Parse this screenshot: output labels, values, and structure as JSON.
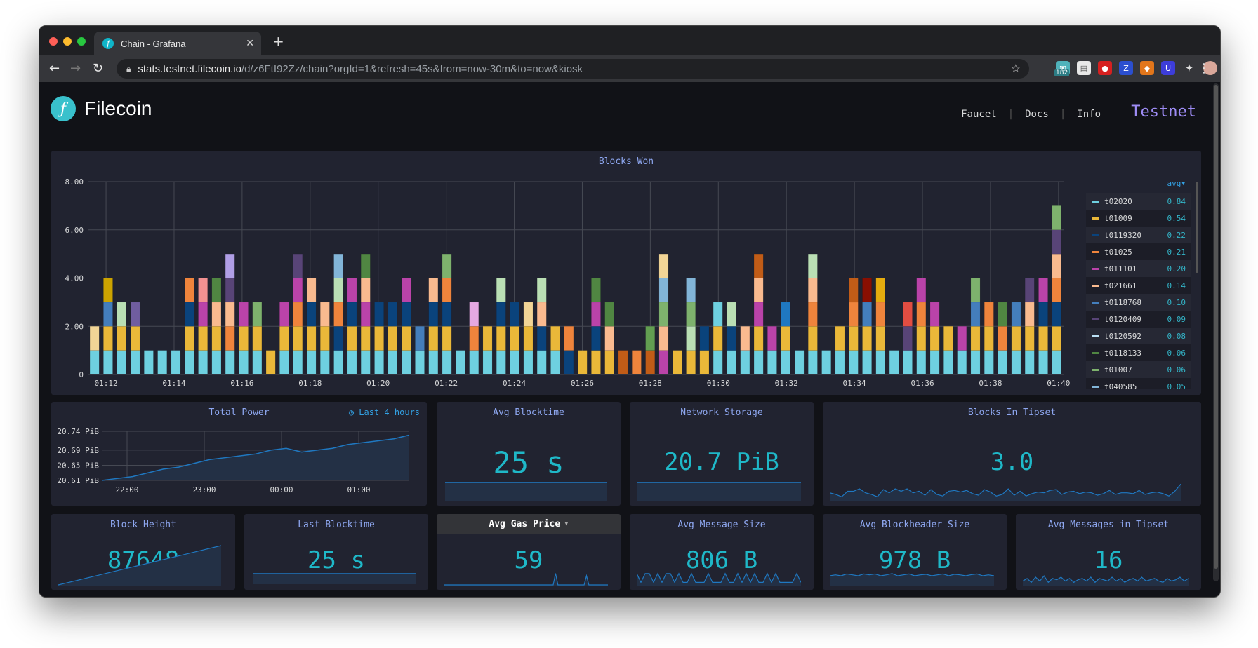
{
  "browser": {
    "tab_title": "Chain - Grafana",
    "url_host": "stats.testnet.filecoin.io",
    "url_path": "/d/z6FtI92Zz/chain?orgId=1&refresh=45s&from=now-30m&to=now&kiosk",
    "extension_badge": "182",
    "colors": {
      "close": "#ff5f57",
      "minimize": "#febc2e",
      "maximize": "#28c840"
    }
  },
  "header": {
    "brand": "Filecoin",
    "logo_glyph": "ƒ",
    "nav": [
      "Faucet",
      "Docs",
      "Info"
    ],
    "network": "Testnet"
  },
  "blocks_won": {
    "title": "Blocks Won",
    "legend_sort": "avg▾",
    "legend": [
      {
        "name": "t02020",
        "value": "0.84",
        "color": "#6ed0e0"
      },
      {
        "name": "t01009",
        "value": "0.54",
        "color": "#eab839"
      },
      {
        "name": "t0119320",
        "value": "0.22",
        "color": "#0a437c"
      },
      {
        "name": "t01025",
        "value": "0.21",
        "color": "#ef843c"
      },
      {
        "name": "t011101",
        "value": "0.20",
        "color": "#ba43a9"
      },
      {
        "name": "t021661",
        "value": "0.14",
        "color": "#f9ba8f"
      },
      {
        "name": "t0118768",
        "value": "0.10",
        "color": "#447ebc"
      },
      {
        "name": "t0120409",
        "value": "0.09",
        "color": "#584477"
      },
      {
        "name": "t0120592",
        "value": "0.08",
        "color": "#badff4"
      },
      {
        "name": "t0118133",
        "value": "0.06",
        "color": "#508642"
      },
      {
        "name": "t01007",
        "value": "0.06",
        "color": "#7eb26d"
      },
      {
        "name": "t040585",
        "value": "0.05",
        "color": "#82b5d8"
      }
    ]
  },
  "chart_data": [
    {
      "type": "bar",
      "title": "Blocks Won",
      "stacked": true,
      "ylim": [
        0,
        8
      ],
      "yticks": [
        "0",
        "2.00",
        "4.00",
        "6.00",
        "8.00"
      ],
      "xticks": [
        "01:12",
        "01:14",
        "01:16",
        "01:18",
        "01:20",
        "01:22",
        "01:24",
        "01:26",
        "01:28",
        "01:30",
        "01:32",
        "01:34",
        "01:36",
        "01:38",
        "01:40"
      ],
      "grid": true,
      "legend_position": "right",
      "stacks": [
        [
          "#6ed0e0",
          "#f2d596"
        ],
        [
          "#6ed0e0",
          "#eab839",
          "#447ebc",
          "#cca300"
        ],
        [
          "#6ed0e0",
          "#eab839",
          "#badfb4"
        ],
        [
          "#6ed0e0",
          "#eab839",
          "#705da0"
        ],
        [
          "#6ed0e0"
        ],
        [
          "#6ed0e0"
        ],
        [
          "#6ed0e0"
        ],
        [
          "#6ed0e0",
          "#eab839",
          "#0a437c",
          "#ef843c"
        ],
        [
          "#6ed0e0",
          "#eab839",
          "#ba43a9",
          "#f29191"
        ],
        [
          "#6ed0e0",
          "#eab839",
          "#f9ba8f",
          "#508642"
        ],
        [
          "#6ed0e0",
          "#ef843c",
          "#f9ba8f",
          "#584477",
          "#b09ee6"
        ],
        [
          "#6ed0e0",
          "#eab839",
          "#ba43a9"
        ],
        [
          "#6ed0e0",
          "#eab839",
          "#7eb26d"
        ],
        [
          "#eab839"
        ],
        [
          "#6ed0e0",
          "#eab839",
          "#ba43a9"
        ],
        [
          "#6ed0e0",
          "#eab839",
          "#ef843c",
          "#ba43a9",
          "#584477"
        ],
        [
          "#6ed0e0",
          "#eab839",
          "#0a437c",
          "#f9ba8f"
        ],
        [
          "#6ed0e0",
          "#eab839",
          "#f9ba8f"
        ],
        [
          "#6ed0e0",
          "#0a437c",
          "#ef843c",
          "#badfb4",
          "#82b5d8"
        ],
        [
          "#6ed0e0",
          "#eab839",
          "#0a437c",
          "#ba43a9"
        ],
        [
          "#6ed0e0",
          "#eab839",
          "#ba43a9",
          "#f9ba8f",
          "#508642"
        ],
        [
          "#6ed0e0",
          "#eab839",
          "#0a437c"
        ],
        [
          "#6ed0e0",
          "#eab839",
          "#0a437c"
        ],
        [
          "#6ed0e0",
          "#eab839",
          "#0a437c",
          "#ba43a9"
        ],
        [
          "#6ed0e0",
          "#447ebc"
        ],
        [
          "#6ed0e0",
          "#eab839",
          "#0a437c",
          "#f9ba8f"
        ],
        [
          "#6ed0e0",
          "#eab839",
          "#0a437c",
          "#ef843c",
          "#7eb26d"
        ],
        [
          "#6ed0e0"
        ],
        [
          "#6ed0e0",
          "#ef843c",
          "#e5a8e2"
        ],
        [
          "#6ed0e0",
          "#eab839"
        ],
        [
          "#6ed0e0",
          "#eab839",
          "#0a437c",
          "#badfb4"
        ],
        [
          "#6ed0e0",
          "#eab839",
          "#0a437c"
        ],
        [
          "#6ed0e0",
          "#eab839",
          "#f2d596"
        ],
        [
          "#6ed0e0",
          "#0a437c",
          "#f9ba8f",
          "#badfb4"
        ],
        [
          "#6ed0e0",
          "#eab839"
        ],
        [
          "#0a437c",
          "#ef843c"
        ],
        [
          "#eab839"
        ],
        [
          "#eab839",
          "#0a437c",
          "#ba43a9",
          "#508642"
        ],
        [
          "#eab839",
          "#f9ba8f",
          "#508642"
        ],
        [
          "#c15c17"
        ],
        [
          "#ef843c"
        ],
        [
          "#c15c17",
          "#629e51"
        ],
        [
          "#ba43a9",
          "#f9ba8f",
          "#7eb26d",
          "#82b5d8",
          "#f2d596"
        ],
        [
          "#eab839"
        ],
        [
          "#eab839",
          "#badfb4",
          "#7eb26d",
          "#82b5d8"
        ],
        [
          "#eab839",
          "#0a437c"
        ],
        [
          "#6ed0e0",
          "#eab839",
          "#6ed0e0"
        ],
        [
          "#6ed0e0",
          "#0a437c",
          "#badfb4"
        ],
        [
          "#6ed0e0",
          "#f9ba8f"
        ],
        [
          "#6ed0e0",
          "#eab839",
          "#ba43a9",
          "#f9ba8f",
          "#c15c17"
        ],
        [
          "#6ed0e0",
          "#ba43a9"
        ],
        [
          "#6ed0e0",
          "#eab839",
          "#1f78c1"
        ],
        [
          "#6ed0e0"
        ],
        [
          "#6ed0e0",
          "#eab839",
          "#ef843c",
          "#f9ba8f",
          "#badfb4"
        ],
        [
          "#6ed0e0"
        ],
        [
          "#6ed0e0",
          "#eab839"
        ],
        [
          "#6ed0e0",
          "#eab839",
          "#ef843c",
          "#c15c17"
        ],
        [
          "#6ed0e0",
          "#eab839",
          "#447ebc",
          "#890f02"
        ],
        [
          "#6ed0e0",
          "#eab839",
          "#ef843c",
          "#e5ac0e"
        ],
        [
          "#6ed0e0"
        ],
        [
          "#6ed0e0",
          "#584477",
          "#e24d42"
        ],
        [
          "#6ed0e0",
          "#eab839",
          "#ef843c",
          "#ba43a9"
        ],
        [
          "#6ed0e0",
          "#eab839",
          "#ba43a9"
        ],
        [
          "#6ed0e0",
          "#eab839"
        ],
        [
          "#6ed0e0",
          "#ba43a9"
        ],
        [
          "#6ed0e0",
          "#eab839",
          "#447ebc",
          "#7eb26d"
        ],
        [
          "#6ed0e0",
          "#eab839",
          "#ef843c"
        ],
        [
          "#6ed0e0",
          "#ef843c",
          "#508642"
        ],
        [
          "#6ed0e0",
          "#eab839",
          "#447ebc"
        ],
        [
          "#6ed0e0",
          "#eab839",
          "#f9ba8f",
          "#584477"
        ],
        [
          "#6ed0e0",
          "#eab839",
          "#0a437c",
          "#ba43a9"
        ],
        [
          "#6ed0e0",
          "#eab839",
          "#0a437c",
          "#ef843c",
          "#f9ba8f",
          "#584477",
          "#7eb26d"
        ]
      ]
    },
    {
      "type": "area",
      "title": "Total Power",
      "ylim": [
        20.61,
        20.74
      ],
      "yticks": [
        "20.61 PiB",
        "20.65 PiB",
        "20.69 PiB",
        "20.74 PiB"
      ],
      "xticks": [
        "22:00",
        "23:00",
        "00:00",
        "01:00"
      ],
      "grid": true,
      "values": [
        20.61,
        20.615,
        20.62,
        20.63,
        20.64,
        20.645,
        20.655,
        20.665,
        20.67,
        20.675,
        20.68,
        20.69,
        20.695,
        20.685,
        20.69,
        20.695,
        20.705,
        20.71,
        20.715,
        20.72,
        20.73
      ]
    }
  ],
  "total_power": {
    "title": "Total Power",
    "time_override": "Last 4 hours"
  },
  "stats": {
    "avg_blocktime": {
      "title": "Avg Blocktime",
      "value": "25 s"
    },
    "network_storage": {
      "title": "Network Storage",
      "value": "20.7 PiB"
    },
    "blocks_in_tipset": {
      "title": "Blocks In Tipset",
      "value": "3.0"
    },
    "block_height": {
      "title": "Block Height",
      "value": "87648"
    },
    "last_blocktime": {
      "title": "Last Blocktime",
      "value": "25 s"
    },
    "avg_gas_price": {
      "title": "Avg Gas Price",
      "value": "59"
    },
    "avg_message_size": {
      "title": "Avg Message Size",
      "value": "806 B"
    },
    "avg_blockheader_size": {
      "title": "Avg Blockheader Size",
      "value": "978 B"
    },
    "avg_messages_in_tipset": {
      "title": "Avg Messages in Tipset",
      "value": "16"
    }
  },
  "sparklines": {
    "blocks_in_tipset": [
      3,
      2.8,
      2.5,
      3.2,
      3.2,
      3.5,
      3,
      2.8,
      2.5,
      3.4,
      3,
      3.5,
      3.2,
      3.5,
      3,
      3.2,
      2.7,
      3.4,
      2.8,
      2.6,
      3.2,
      3.3,
      3.1,
      3.3,
      2.9,
      2.7,
      3.4,
      3.1,
      2.6,
      2.8,
      3.5,
      2.7,
      3.2,
      2.6,
      2.9,
      3.1,
      3,
      3.3,
      3.4,
      2.8,
      3.1,
      3.2,
      2.9,
      3.1,
      3,
      2.7,
      2.9,
      3.3,
      2.8,
      3,
      3,
      2.9,
      3.3,
      2.8,
      3,
      3.1,
      2.9,
      2.6,
      3.2,
      4.1
    ],
    "block_height": [
      0,
      0.1,
      0.2,
      0.3,
      0.4,
      0.5,
      0.6,
      0.7,
      0.8,
      0.9,
      1
    ],
    "avg_gas_price": [
      0,
      0,
      0,
      0,
      0,
      0,
      0,
      0,
      0,
      0,
      0,
      0,
      0,
      0,
      0,
      0,
      0,
      0,
      0,
      0,
      0,
      0,
      0,
      0,
      0,
      0,
      0,
      0,
      0,
      0,
      0,
      0,
      0,
      0,
      0,
      0,
      0,
      0,
      0,
      0,
      0,
      0,
      0,
      0,
      0,
      0,
      0,
      1,
      0,
      0,
      0,
      0,
      0,
      0,
      0,
      0,
      0,
      0,
      0,
      0,
      0.8,
      0,
      0,
      0,
      0,
      0,
      0,
      0,
      0,
      0
    ],
    "avg_message_size": [
      0.9,
      0.2,
      0.9,
      0.9,
      0.2,
      0.9,
      0.2,
      0.9,
      0.9,
      0.2,
      0.9,
      0.2,
      0.2,
      0.9,
      0.2,
      0.2,
      0.2,
      0.9,
      0.2,
      0.2,
      0.2,
      0.9,
      0.2,
      0.2,
      0.9,
      0.2,
      0.9,
      0.2,
      0.9,
      0.2,
      0.2,
      0.9,
      0.2,
      0.9,
      0.2,
      0.2,
      0.2,
      0.2,
      0.9,
      0.2
    ],
    "avg_blockheader_size": [
      0.5,
      0.55,
      0.5,
      0.6,
      0.55,
      0.5,
      0.6,
      0.55,
      0.6,
      0.5,
      0.55,
      0.62,
      0.5,
      0.55,
      0.6,
      0.5,
      0.55,
      0.58,
      0.5,
      0.55,
      0.6,
      0.5,
      0.58,
      0.55,
      0.5,
      0.56,
      0.6,
      0.5,
      0.55,
      0.5
    ],
    "avg_messages_in_tipset": [
      0.3,
      0.5,
      0.2,
      0.6,
      0.3,
      0.7,
      0.2,
      0.5,
      0.4,
      0.6,
      0.3,
      0.5,
      0.2,
      0.4,
      0.5,
      0.3,
      0.6,
      0.2,
      0.5,
      0.4,
      0.3,
      0.6,
      0.3,
      0.5,
      0.2,
      0.4,
      0.5,
      0.3,
      0.6,
      0.3,
      0.4,
      0.5,
      0.3,
      0.2,
      0.5,
      0.3,
      0.4,
      0.6,
      0.3,
      0.5
    ]
  }
}
